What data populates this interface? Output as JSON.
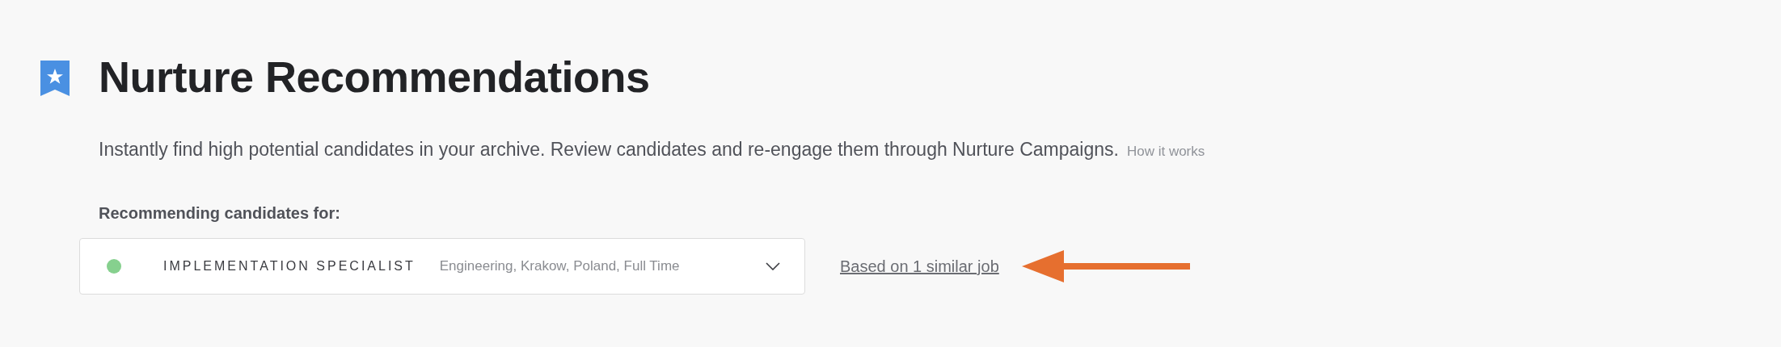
{
  "header": {
    "title": "Nurture Recommendations",
    "description": "Instantly find high potential candidates in your archive. Review candidates and re-engage them through Nurture Campaigns.",
    "help_link": "How it works"
  },
  "recommending": {
    "label": "Recommending candidates for:",
    "job": {
      "color": "#86d08e",
      "title": "IMPLEMENTATION SPECIALIST",
      "details": "Engineering, Krakow, Poland, Full Time"
    },
    "similar_link": "Based on 1 similar job"
  }
}
